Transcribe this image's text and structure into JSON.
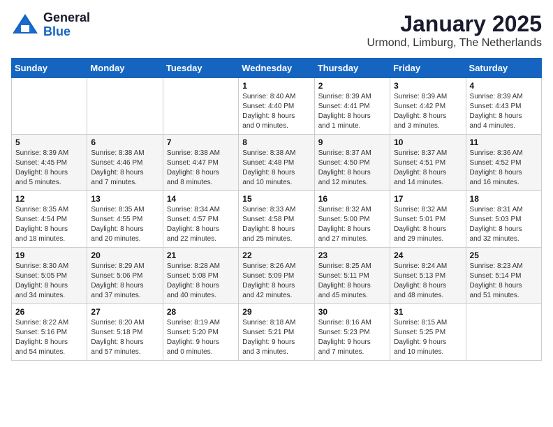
{
  "logo": {
    "general": "General",
    "blue": "Blue"
  },
  "title": "January 2025",
  "location": "Urmond, Limburg, The Netherlands",
  "weekdays": [
    "Sunday",
    "Monday",
    "Tuesday",
    "Wednesday",
    "Thursday",
    "Friday",
    "Saturday"
  ],
  "weeks": [
    [
      {
        "day": "",
        "info": ""
      },
      {
        "day": "",
        "info": ""
      },
      {
        "day": "",
        "info": ""
      },
      {
        "day": "1",
        "info": "Sunrise: 8:40 AM\nSunset: 4:40 PM\nDaylight: 8 hours\nand 0 minutes."
      },
      {
        "day": "2",
        "info": "Sunrise: 8:39 AM\nSunset: 4:41 PM\nDaylight: 8 hours\nand 1 minute."
      },
      {
        "day": "3",
        "info": "Sunrise: 8:39 AM\nSunset: 4:42 PM\nDaylight: 8 hours\nand 3 minutes."
      },
      {
        "day": "4",
        "info": "Sunrise: 8:39 AM\nSunset: 4:43 PM\nDaylight: 8 hours\nand 4 minutes."
      }
    ],
    [
      {
        "day": "5",
        "info": "Sunrise: 8:39 AM\nSunset: 4:45 PM\nDaylight: 8 hours\nand 5 minutes."
      },
      {
        "day": "6",
        "info": "Sunrise: 8:38 AM\nSunset: 4:46 PM\nDaylight: 8 hours\nand 7 minutes."
      },
      {
        "day": "7",
        "info": "Sunrise: 8:38 AM\nSunset: 4:47 PM\nDaylight: 8 hours\nand 8 minutes."
      },
      {
        "day": "8",
        "info": "Sunrise: 8:38 AM\nSunset: 4:48 PM\nDaylight: 8 hours\nand 10 minutes."
      },
      {
        "day": "9",
        "info": "Sunrise: 8:37 AM\nSunset: 4:50 PM\nDaylight: 8 hours\nand 12 minutes."
      },
      {
        "day": "10",
        "info": "Sunrise: 8:37 AM\nSunset: 4:51 PM\nDaylight: 8 hours\nand 14 minutes."
      },
      {
        "day": "11",
        "info": "Sunrise: 8:36 AM\nSunset: 4:52 PM\nDaylight: 8 hours\nand 16 minutes."
      }
    ],
    [
      {
        "day": "12",
        "info": "Sunrise: 8:35 AM\nSunset: 4:54 PM\nDaylight: 8 hours\nand 18 minutes."
      },
      {
        "day": "13",
        "info": "Sunrise: 8:35 AM\nSunset: 4:55 PM\nDaylight: 8 hours\nand 20 minutes."
      },
      {
        "day": "14",
        "info": "Sunrise: 8:34 AM\nSunset: 4:57 PM\nDaylight: 8 hours\nand 22 minutes."
      },
      {
        "day": "15",
        "info": "Sunrise: 8:33 AM\nSunset: 4:58 PM\nDaylight: 8 hours\nand 25 minutes."
      },
      {
        "day": "16",
        "info": "Sunrise: 8:32 AM\nSunset: 5:00 PM\nDaylight: 8 hours\nand 27 minutes."
      },
      {
        "day": "17",
        "info": "Sunrise: 8:32 AM\nSunset: 5:01 PM\nDaylight: 8 hours\nand 29 minutes."
      },
      {
        "day": "18",
        "info": "Sunrise: 8:31 AM\nSunset: 5:03 PM\nDaylight: 8 hours\nand 32 minutes."
      }
    ],
    [
      {
        "day": "19",
        "info": "Sunrise: 8:30 AM\nSunset: 5:05 PM\nDaylight: 8 hours\nand 34 minutes."
      },
      {
        "day": "20",
        "info": "Sunrise: 8:29 AM\nSunset: 5:06 PM\nDaylight: 8 hours\nand 37 minutes."
      },
      {
        "day": "21",
        "info": "Sunrise: 8:28 AM\nSunset: 5:08 PM\nDaylight: 8 hours\nand 40 minutes."
      },
      {
        "day": "22",
        "info": "Sunrise: 8:26 AM\nSunset: 5:09 PM\nDaylight: 8 hours\nand 42 minutes."
      },
      {
        "day": "23",
        "info": "Sunrise: 8:25 AM\nSunset: 5:11 PM\nDaylight: 8 hours\nand 45 minutes."
      },
      {
        "day": "24",
        "info": "Sunrise: 8:24 AM\nSunset: 5:13 PM\nDaylight: 8 hours\nand 48 minutes."
      },
      {
        "day": "25",
        "info": "Sunrise: 8:23 AM\nSunset: 5:14 PM\nDaylight: 8 hours\nand 51 minutes."
      }
    ],
    [
      {
        "day": "26",
        "info": "Sunrise: 8:22 AM\nSunset: 5:16 PM\nDaylight: 8 hours\nand 54 minutes."
      },
      {
        "day": "27",
        "info": "Sunrise: 8:20 AM\nSunset: 5:18 PM\nDaylight: 8 hours\nand 57 minutes."
      },
      {
        "day": "28",
        "info": "Sunrise: 8:19 AM\nSunset: 5:20 PM\nDaylight: 9 hours\nand 0 minutes."
      },
      {
        "day": "29",
        "info": "Sunrise: 8:18 AM\nSunset: 5:21 PM\nDaylight: 9 hours\nand 3 minutes."
      },
      {
        "day": "30",
        "info": "Sunrise: 8:16 AM\nSunset: 5:23 PM\nDaylight: 9 hours\nand 7 minutes."
      },
      {
        "day": "31",
        "info": "Sunrise: 8:15 AM\nSunset: 5:25 PM\nDaylight: 9 hours\nand 10 minutes."
      },
      {
        "day": "",
        "info": ""
      }
    ]
  ]
}
